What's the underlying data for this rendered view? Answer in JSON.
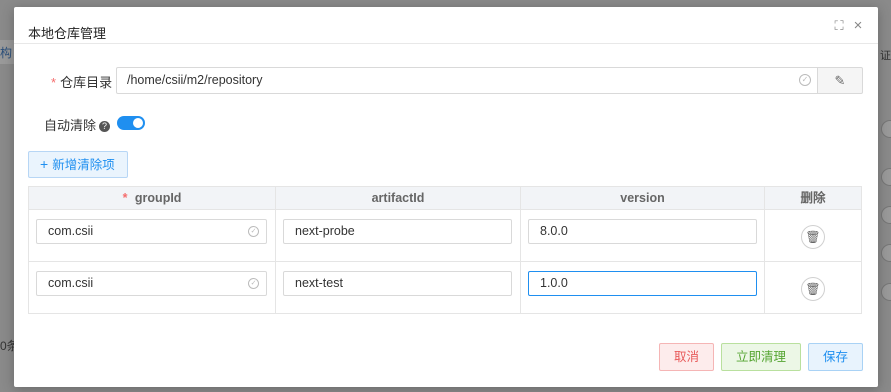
{
  "backdrop": {
    "left_text": "构",
    "bottom_left_text": "0条",
    "top_right_text": "证"
  },
  "modal": {
    "title": "本地仓库管理",
    "maximize_icon": "⛶",
    "close_icon": "×"
  },
  "form": {
    "repo_label": "仓库目录",
    "repo_required": "*",
    "repo_path": "/home/csii/m2/repository",
    "auto_clean_label": "自动清除",
    "auto_clean_enabled": true,
    "add_button": "新增清除项"
  },
  "table": {
    "columns": [
      "groupId",
      "artifactId",
      "version",
      "删除"
    ],
    "groupId_required": "*",
    "rows": [
      {
        "groupId": "com.csii",
        "artifactId": "next-probe",
        "version": "8.0.0"
      },
      {
        "groupId": "com.csii",
        "artifactId": "next-test",
        "version": "1.0.0"
      }
    ]
  },
  "footer": {
    "cancel": "取消",
    "clean_now": "立即清理",
    "save": "保存"
  },
  "colors": {
    "accent": "#1f8ff0",
    "danger": "#e85a5a",
    "success": "#55a532"
  }
}
